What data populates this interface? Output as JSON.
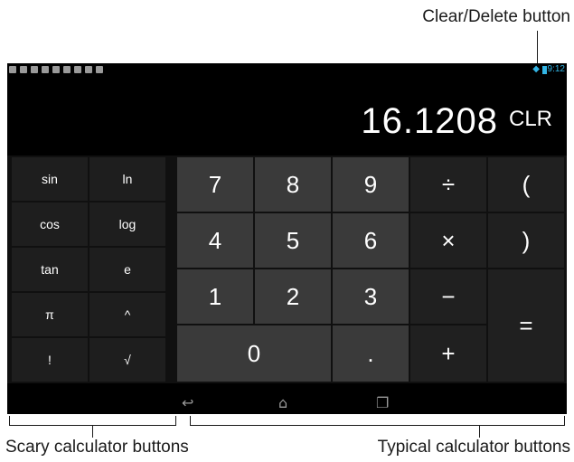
{
  "callouts": {
    "clear_delete": "Clear/Delete button",
    "scary": "Scary calculator buttons",
    "typical": "Typical calculator buttons"
  },
  "status_bar": {
    "time": "9:12",
    "wifi": "wifi-icon",
    "battery": "battery-icon"
  },
  "display": {
    "result": "16.1208",
    "clear_label": "CLR"
  },
  "advanced_keys": [
    "sin",
    "ln",
    "cos",
    "log",
    "tan",
    "e",
    "π",
    "^",
    "!",
    "√"
  ],
  "number_keys": [
    "7",
    "8",
    "9",
    "4",
    "5",
    "6",
    "1",
    "2",
    "3",
    "0",
    "."
  ],
  "operator_keys": [
    "÷",
    "(",
    "×",
    ")",
    "−",
    "=",
    "+"
  ],
  "nav_bar": {
    "back": "back-icon",
    "home": "home-icon",
    "recents": "recents-icon"
  },
  "colors": {
    "accent": "#33b5e5",
    "numpad": "#3a3a3a",
    "ops": "#202020",
    "advanced": "#1e1e1e"
  }
}
